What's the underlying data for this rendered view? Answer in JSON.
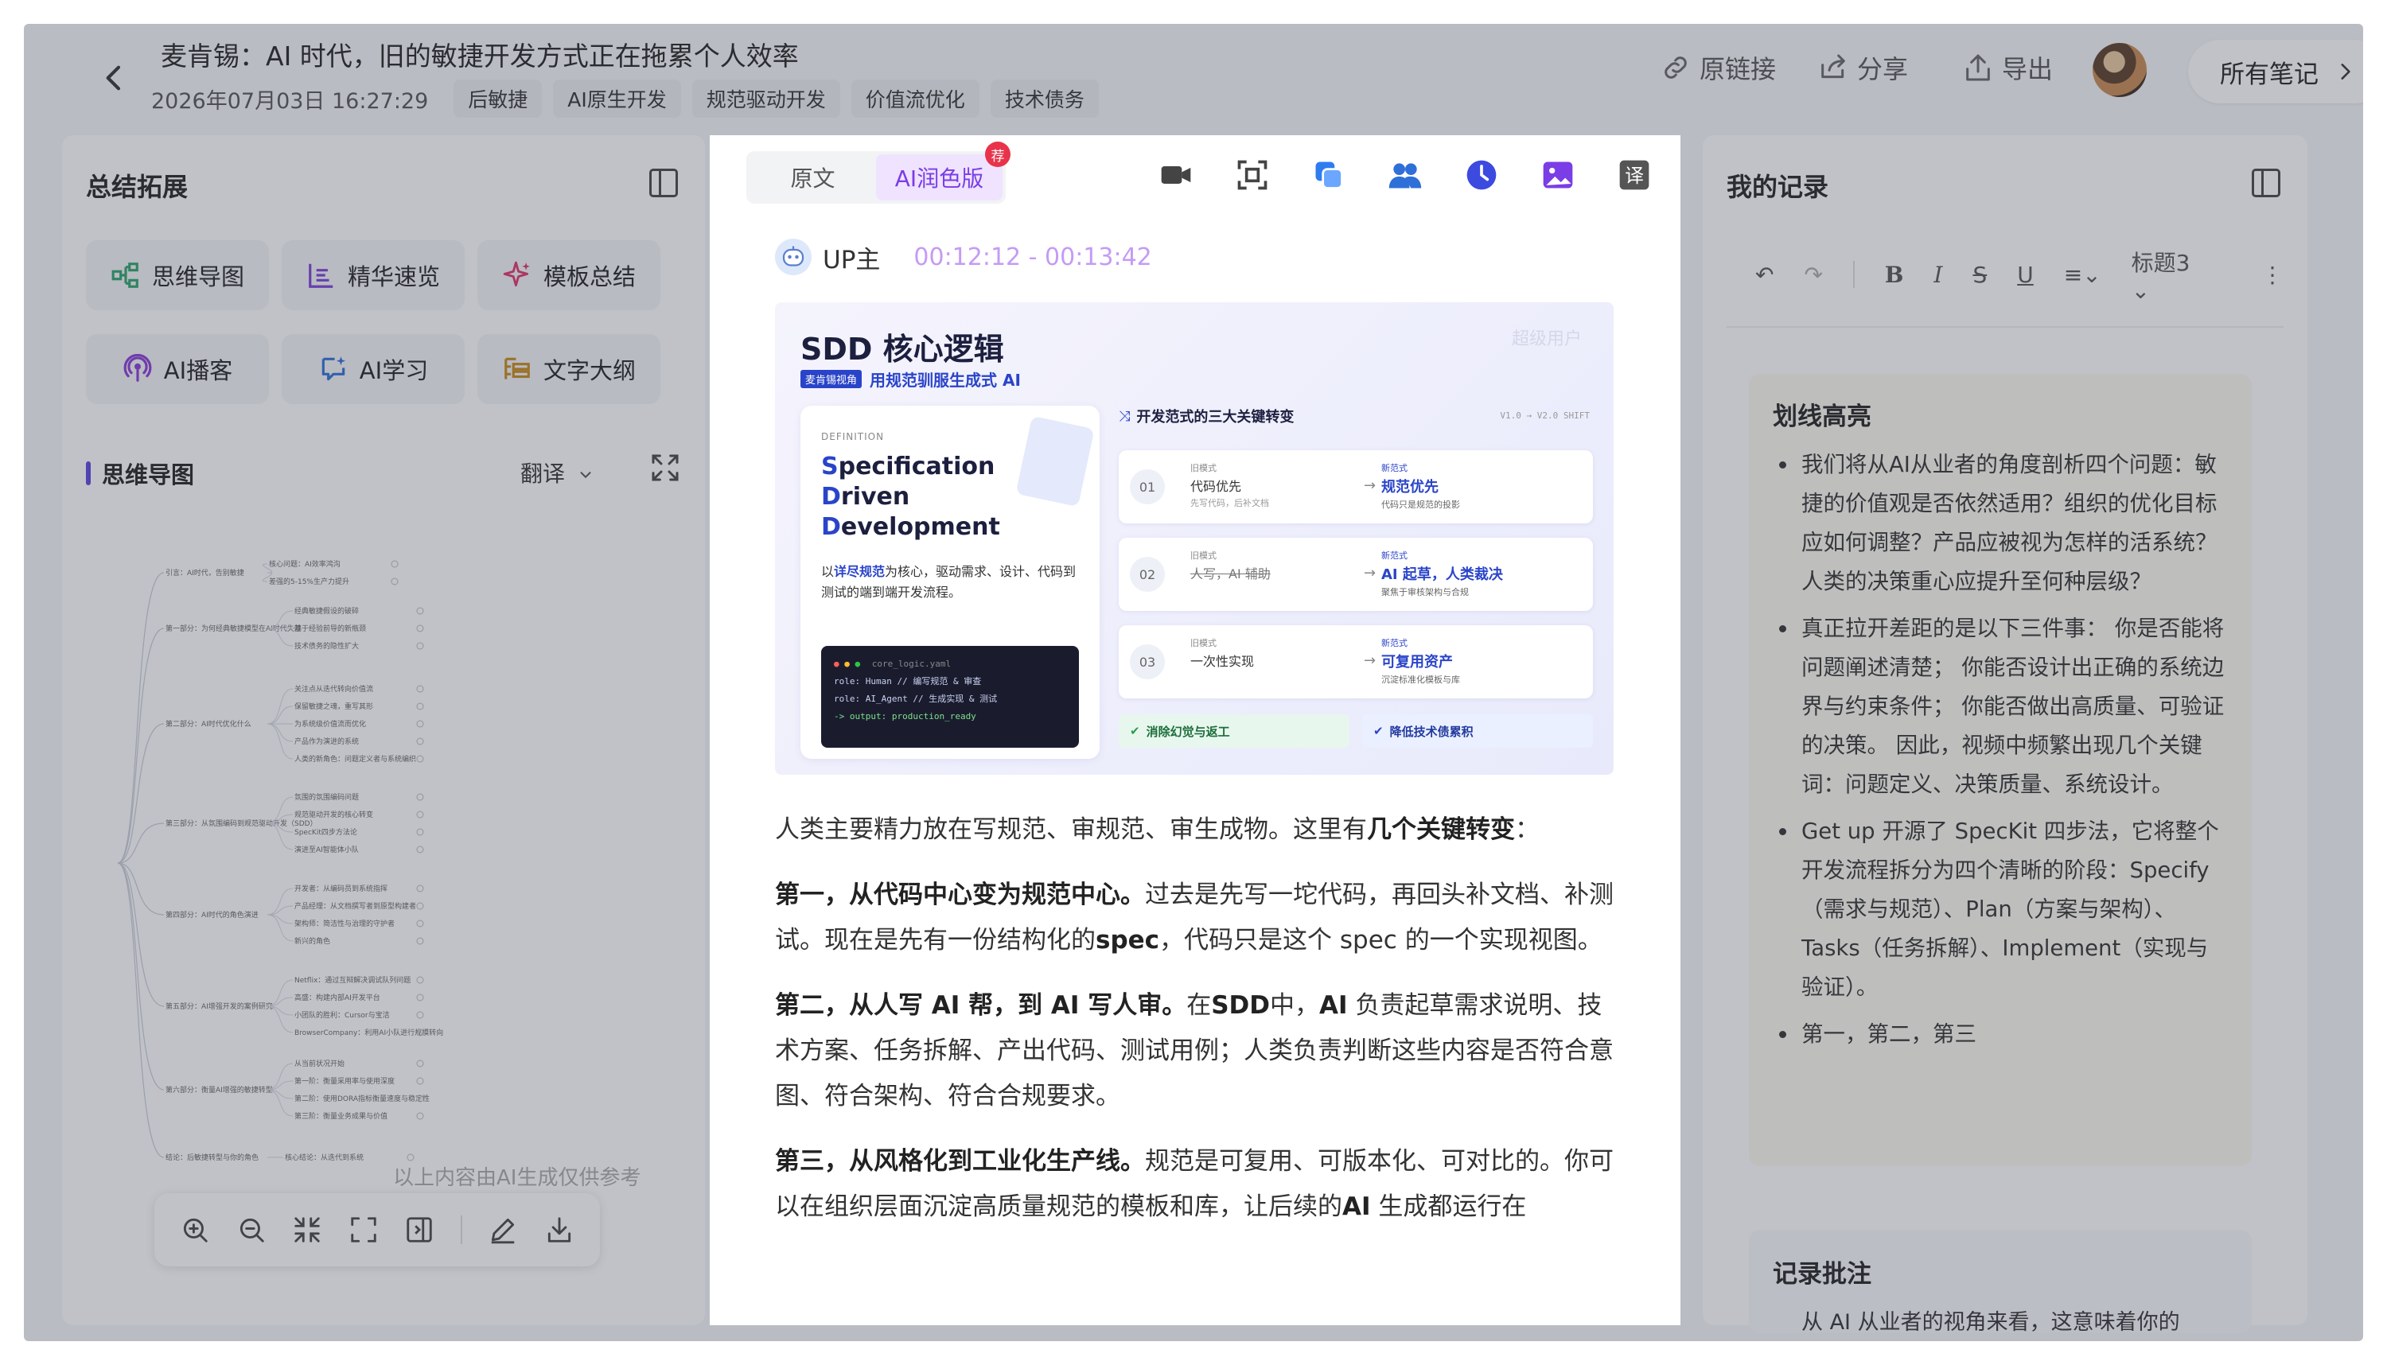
{
  "header": {
    "back_label": "‹",
    "title": "麦肯锡：AI 时代，旧的敏捷开发方式正在拖累个人效率",
    "date": "2026年07月03日 16:27:29",
    "tags": [
      "后敏捷",
      "AI原生开发",
      "规范驱动开发",
      "价值流优化",
      "技术债务"
    ],
    "actions": {
      "link": "原链接",
      "share": "分享",
      "export": "导出"
    },
    "all_notes": "所有笔记"
  },
  "left": {
    "title": "总结拓展",
    "features": [
      "思维导图",
      "精华速览",
      "模板总结",
      "AI播客",
      "AI学习",
      "文字大纲"
    ],
    "mindmap_title": "思维导图",
    "translate": "翻译",
    "disclaimer": "以上内容由AI生成仅供参考",
    "mindmap": {
      "sections": [
        {
          "label": "引言：AI时代，告别敏捷",
          "children": [
            "核心问题：AI效率鸿沟",
            "差强的5-15%生产力提升"
          ]
        },
        {
          "label": "第一部分：为何经典敏捷模型在AI时代失效",
          "children": [
            "经典敏捷假设的破碎",
            "基于经验前导的新瓶颈",
            "技术债务的隐性扩大"
          ]
        },
        {
          "label": "第二部分：AI时代优化什么",
          "children": [
            "关注点从迭代转向价值流",
            "保留敏捷之魂，重写其形",
            "为系统级价值流而优化",
            "产品作为演进的系统",
            "人类的新角色：问题定义者与系统编织"
          ]
        },
        {
          "label": "第三部分：从氛围编码到规范驱动开发（SDD）",
          "children": [
            "氛围的氛围编码问题",
            "规范驱动开发的核心转变",
            "SpecKit四步方法论",
            "演进至AI智能体小队"
          ]
        },
        {
          "label": "第四部分：AI时代的角色演进",
          "children": [
            "开发者：从编码员到系统指挥",
            "产品经理：从文档撰写者到原型构建者",
            "架构师：简洁性与治理的守护者",
            "新兴的角色"
          ]
        },
        {
          "label": "第五部分：AI增强开发的案例研究",
          "children": [
            "Netflix：通过互辩解决调试队列问题",
            "高盛：构建内部AI开发平台",
            "小团队的胜利：Cursor与宝洁",
            "BrowserCompany：利用AI小队进行规模转向"
          ]
        },
        {
          "label": "第六部分：衡量AI增强的敏捷转型",
          "children": [
            "从当前状况开始",
            "第一阶：衡量采用率与使用深度",
            "第二阶：使用DORA指标衡量速度与稳定性",
            "第三阶：衡量业务成果与价值"
          ]
        },
        {
          "label": "结论：后敏捷转型与你的角色",
          "children": [
            "核心结论：从迭代到系统"
          ]
        }
      ]
    }
  },
  "middle": {
    "tabs": [
      "原文",
      "AI润色版"
    ],
    "active_tab": "AI润色版",
    "badge": "荐",
    "speaker": "UP主",
    "timestamp": "00:12:12 - 00:13:42",
    "slide": {
      "title": "SDD 核心逻辑",
      "watermark": "超级用户",
      "tag": "麦肯锡视角",
      "subtitle": "用规范驯服生成式 AI",
      "def_label": "DEFINITION",
      "def_lines": [
        [
          "S",
          "pecification"
        ],
        [
          "D",
          "riven"
        ],
        [
          "D",
          "evelopment"
        ]
      ],
      "def_desc_a": "以",
      "def_desc_b": "详尽规范",
      "def_desc_c": "为核心，驱动需求、设计、代码到测试的端到端开发流程。",
      "code_file": "core_logic.yaml",
      "code_lines": [
        "role: Human   // 编写规范 & 审查",
        "role: AI_Agent  // 生成实现 & 测试",
        "-> output: production_ready"
      ],
      "shift_title": "开发范式的三大关键转变",
      "version": "V1.0 → V2.0 SHIFT",
      "shifts": [
        {
          "num": "01",
          "old_label": "旧模式",
          "old": "代码优先",
          "old_desc": "先写代码，后补文档",
          "new_label": "新范式",
          "new": "规范优先",
          "new_desc": "代码只是规范的投影"
        },
        {
          "num": "02",
          "old_label": "旧模式",
          "old": "人写，AI 辅助",
          "old_desc": "",
          "new_label": "新范式",
          "new": "AI 起草，人类裁决",
          "new_desc": "聚焦于审核架构与合规"
        },
        {
          "num": "03",
          "old_label": "旧模式",
          "old": "一次性实现",
          "old_desc": "",
          "new_label": "新范式",
          "new": "可复用资产",
          "new_desc": "沉淀标准化模板与库"
        }
      ],
      "bottom": [
        "消除幻觉与返工",
        "降低技术债累积"
      ]
    },
    "article": {
      "p1_a": "人类主要精力放在写规范、审规范、审生成物。这里有",
      "p1_b": "几个关键转变",
      "p1_c": "：",
      "p2_a": "第一，从代码中心变为规范中心。",
      "p2_b": "过去是先写一坨代码，再回头补文档、补测试。现在是先有一份结构化的",
      "p2_c": "spec",
      "p2_d": "，代码只是这个 spec 的一个实现视图。",
      "p3_a": "第二，从人写 AI 帮，到 AI 写人审。",
      "p3_b": "在",
      "p3_c": "SDD",
      "p3_d": "中，",
      "p3_e": "AI",
      "p3_f": " 负责起草需求说明、技术方案、任务拆解、产出代码、测试用例；人类负责判断这些内容是否符合意图、符合架构、符合合规要求。",
      "p4_a": "第三，从风格化到工业化生产线。",
      "p4_b": "规范是可复用、可版本化、可对比的。你可以在组织层面沉淀高质量规范的模板和库，让后续的",
      "p4_c": "AI",
      "p4_d": " 生成都运行在"
    }
  },
  "right": {
    "title": "我的记录",
    "toolbar": {
      "heading": "标题3"
    },
    "highlight_title": "划线高亮",
    "highlights": [
      "我们将从AI从业者的角度剖析四个问题：敏捷的价值观是否依然适用？组织的优化目标应如何调整？产品应被视为怎样的活系统？人类的决策重心应提升至何种层级？",
      "真正拉开差距的是以下三件事： 你是否能将问题阐述清楚； 你能否设计出正确的系统边界与约束条件； 你能否做出高质量、可验证的决策。 因此，视频中频繁出现几个关键词：问题定义、决策质量、系统设计。",
      "Get up 开源了 SpecKit 四步法，它将整个开发流程拆分为四个清晰的阶段：Specify（需求与规范）、Plan（方案与架构）、Tasks（任务拆解）、Implement（实现与验证）。",
      "第一，第二，第三"
    ],
    "comment_title": "记录批注",
    "comment_text": "从 AI 从业者的视角来看，这意味着你的"
  }
}
